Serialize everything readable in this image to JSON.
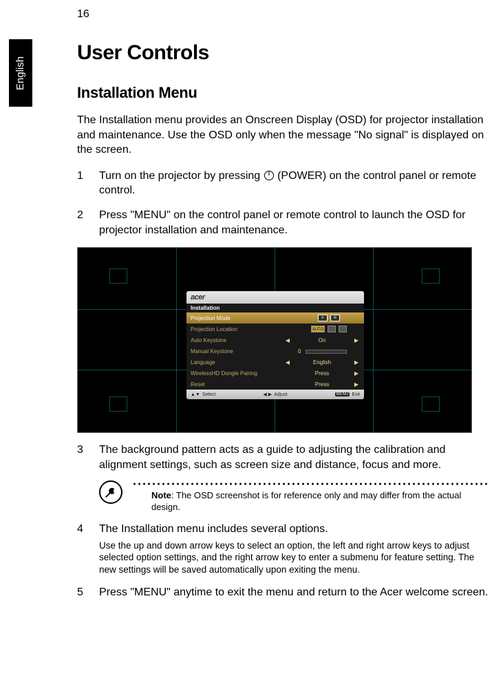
{
  "page_number": "16",
  "language_tab": "English",
  "h1": "User Controls",
  "h2": "Installation Menu",
  "intro": "The Installation menu provides an Onscreen Display (OSD) for projector installation and maintenance. Use the OSD only when the message \"No signal\" is displayed on the screen.",
  "steps": {
    "s1_num": "1",
    "s1_pre": "Turn on the projector by pressing ",
    "s1_post": " (POWER) on the control panel or remote control.",
    "s2_num": "2",
    "s2": "Press \"MENU\" on the control panel or remote control to launch the OSD for projector installation and maintenance.",
    "s3_num": "3",
    "s3": "The background pattern acts as a guide to adjusting the calibration and alignment settings, such as screen size and distance, focus and more.",
    "s4_num": "4",
    "s4": "The Installation menu includes several options.",
    "s4_sub": "Use the up and down arrow keys to select an option, the left and right arrow keys to adjust selected option settings, and the right arrow key to enter a submenu for feature setting. The new settings will be saved automatically upon exiting the menu.",
    "s5_num": "5",
    "s5": "Press \"MENU\" anytime to exit the menu and return to the Acer welcome screen."
  },
  "note": {
    "label": "Note",
    "text": ": The OSD screenshot is for reference only and may differ from the actual design."
  },
  "osd": {
    "brand": "acer",
    "title": "Installation",
    "rows": {
      "proj_mode": "Projection Mode",
      "proj_mode_icon1": "F",
      "proj_mode_icon2": "R",
      "proj_loc": "Projection Location",
      "proj_loc_auto": "AUTO",
      "auto_keystone": "Auto Keystone",
      "auto_keystone_val": "On",
      "manual_keystone": "Manual Keystone",
      "manual_keystone_val": "0",
      "language": "Language",
      "language_val": "English",
      "pairing": "WirelessHD Dongle Pairing",
      "pairing_val": "Press",
      "reset": "Reset",
      "reset_val": "Press"
    },
    "footer": {
      "select_keys": "▲▼",
      "select": "Select",
      "adjust_keys": "◀ ▶",
      "adjust": "Adjust",
      "menu_key": "MENU",
      "exit": "Exit"
    }
  }
}
